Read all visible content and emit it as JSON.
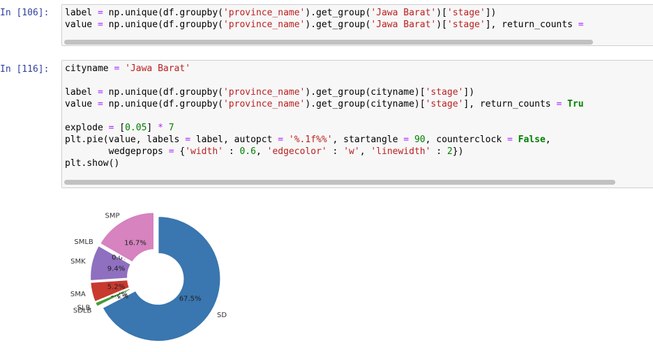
{
  "cells": [
    {
      "prompt": "In [106]:",
      "lines": [
        [
          {
            "t": "label ",
            "c": ""
          },
          {
            "t": "=",
            "c": "op"
          },
          {
            "t": " np.unique(df.groupby(",
            "c": ""
          },
          {
            "t": "'province_name'",
            "c": "str"
          },
          {
            "t": ").get_group(",
            "c": ""
          },
          {
            "t": "'Jawa Barat'",
            "c": "str"
          },
          {
            "t": ")[",
            "c": ""
          },
          {
            "t": "'stage'",
            "c": "str"
          },
          {
            "t": "])",
            "c": ""
          }
        ],
        [
          {
            "t": "value ",
            "c": ""
          },
          {
            "t": "=",
            "c": "op"
          },
          {
            "t": " np.unique(df.groupby(",
            "c": ""
          },
          {
            "t": "'province_name'",
            "c": "str"
          },
          {
            "t": ").get_group(",
            "c": ""
          },
          {
            "t": "'Jawa Barat'",
            "c": "str"
          },
          {
            "t": ")[",
            "c": ""
          },
          {
            "t": "'stage'",
            "c": "str"
          },
          {
            "t": "], return_counts ",
            "c": ""
          },
          {
            "t": "=",
            "c": "op"
          }
        ]
      ]
    },
    {
      "prompt": "In [116]:",
      "lines": [
        [
          {
            "t": "cityname ",
            "c": ""
          },
          {
            "t": "=",
            "c": "op"
          },
          {
            "t": " ",
            "c": ""
          },
          {
            "t": "'Jawa Barat'",
            "c": "str"
          }
        ],
        [],
        [
          {
            "t": "label ",
            "c": ""
          },
          {
            "t": "=",
            "c": "op"
          },
          {
            "t": " np.unique(df.groupby(",
            "c": ""
          },
          {
            "t": "'province_name'",
            "c": "str"
          },
          {
            "t": ").get_group(cityname)[",
            "c": ""
          },
          {
            "t": "'stage'",
            "c": "str"
          },
          {
            "t": "])",
            "c": ""
          }
        ],
        [
          {
            "t": "value ",
            "c": ""
          },
          {
            "t": "=",
            "c": "op"
          },
          {
            "t": " np.unique(df.groupby(",
            "c": ""
          },
          {
            "t": "'province_name'",
            "c": "str"
          },
          {
            "t": ").get_group(cityname)[",
            "c": ""
          },
          {
            "t": "'stage'",
            "c": "str"
          },
          {
            "t": "], return_counts ",
            "c": ""
          },
          {
            "t": "=",
            "c": "op"
          },
          {
            "t": " ",
            "c": ""
          },
          {
            "t": "Tru",
            "c": "kw"
          }
        ],
        [],
        [
          {
            "t": "explode ",
            "c": ""
          },
          {
            "t": "=",
            "c": "op"
          },
          {
            "t": " [",
            "c": ""
          },
          {
            "t": "0.05",
            "c": "num"
          },
          {
            "t": "] ",
            "c": ""
          },
          {
            "t": "*",
            "c": "op"
          },
          {
            "t": " ",
            "c": ""
          },
          {
            "t": "7",
            "c": "num"
          }
        ],
        [
          {
            "t": "plt.pie(value, labels ",
            "c": ""
          },
          {
            "t": "=",
            "c": "op"
          },
          {
            "t": " label, autopct ",
            "c": ""
          },
          {
            "t": "=",
            "c": "op"
          },
          {
            "t": " ",
            "c": ""
          },
          {
            "t": "'%.1f%%'",
            "c": "str"
          },
          {
            "t": ", startangle ",
            "c": ""
          },
          {
            "t": "=",
            "c": "op"
          },
          {
            "t": " ",
            "c": ""
          },
          {
            "t": "90",
            "c": "num"
          },
          {
            "t": ", counterclock ",
            "c": ""
          },
          {
            "t": "=",
            "c": "op"
          },
          {
            "t": " ",
            "c": ""
          },
          {
            "t": "False",
            "c": "kw"
          },
          {
            "t": ",",
            "c": ""
          }
        ],
        [
          {
            "t": "        wedgeprops ",
            "c": ""
          },
          {
            "t": "=",
            "c": "op"
          },
          {
            "t": " {",
            "c": ""
          },
          {
            "t": "'width'",
            "c": "str"
          },
          {
            "t": " : ",
            "c": ""
          },
          {
            "t": "0.6",
            "c": "num"
          },
          {
            "t": ", ",
            "c": ""
          },
          {
            "t": "'edgecolor'",
            "c": "str"
          },
          {
            "t": " : ",
            "c": ""
          },
          {
            "t": "'w'",
            "c": "str"
          },
          {
            "t": ", ",
            "c": ""
          },
          {
            "t": "'linewidth'",
            "c": "str"
          },
          {
            "t": " : ",
            "c": ""
          },
          {
            "t": "2",
            "c": "num"
          },
          {
            "t": "})",
            "c": ""
          }
        ],
        [
          {
            "t": "plt.show()",
            "c": ""
          }
        ]
      ]
    }
  ],
  "chart_data": {
    "type": "pie",
    "style": "donut",
    "startangle": 90,
    "counterclock": false,
    "title": "",
    "slices": [
      {
        "label": "SD",
        "value": 67.5,
        "pct_label": "67.5%",
        "color": "#3a76af"
      },
      {
        "label": "SDLB",
        "value": 0.2,
        "pct_label": "0.2%",
        "color": "#a8a8a8"
      },
      {
        "label": "SLB",
        "value": 1.2,
        "pct_label": "1.2%",
        "color": "#4a9a3a"
      },
      {
        "label": "SMA",
        "value": 5.2,
        "pct_label": "5.2%",
        "color": "#c83a2e"
      },
      {
        "label": "SMK",
        "value": 9.4,
        "pct_label": "9.4%",
        "color": "#8f6fbf"
      },
      {
        "label": "SMLB",
        "value": 0.0,
        "pct_label": "0.0%",
        "color": "#8b5a4c"
      },
      {
        "label": "SMP",
        "value": 16.7,
        "pct_label": "16.7%",
        "color": "#d683c0"
      }
    ]
  }
}
